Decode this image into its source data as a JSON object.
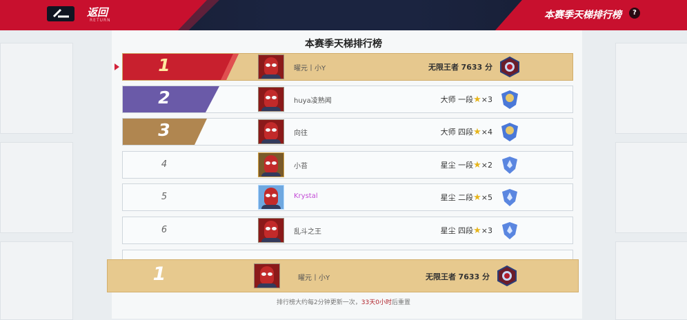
{
  "header": {
    "back_label": "返回",
    "back_sub": "RETURN",
    "page_title": "本赛季天梯排行榜",
    "help_label": "?"
  },
  "board": {
    "title": "本赛季天梯排行榜",
    "rows": [
      {
        "rank": "1",
        "name": "曜元丨小Y",
        "tier": "无限王者",
        "score": "7633 分",
        "stars": ""
      },
      {
        "rank": "2",
        "name": "huya凌熟闻",
        "tier": "大师 一段",
        "score": "",
        "stars": "×3"
      },
      {
        "rank": "3",
        "name": "向往",
        "tier": "大师 四段",
        "score": "",
        "stars": "×4"
      },
      {
        "rank": "4",
        "name": "小苔",
        "tier": "星尘 一段",
        "score": "",
        "stars": "×2"
      },
      {
        "rank": "5",
        "name": "Krystal",
        "tier": "星尘 二段",
        "score": "",
        "stars": "×5"
      },
      {
        "rank": "6",
        "name": "乱斗之王",
        "tier": "星尘 四段",
        "score": "",
        "stars": "×3"
      }
    ]
  },
  "self_row": {
    "rank": "1",
    "name": "曜元丨小Y",
    "tier": "无限王者",
    "score": "7633 分"
  },
  "footer": {
    "text": "排行榜大约每2分钟更新一次，",
    "highlight": "33天0小时",
    "suffix": "后重置"
  },
  "colors": {
    "accent_red": "#c8102e",
    "gold": "#e6c88e",
    "silver_purple": "#6a5aa8",
    "bronze": "#b08650"
  }
}
